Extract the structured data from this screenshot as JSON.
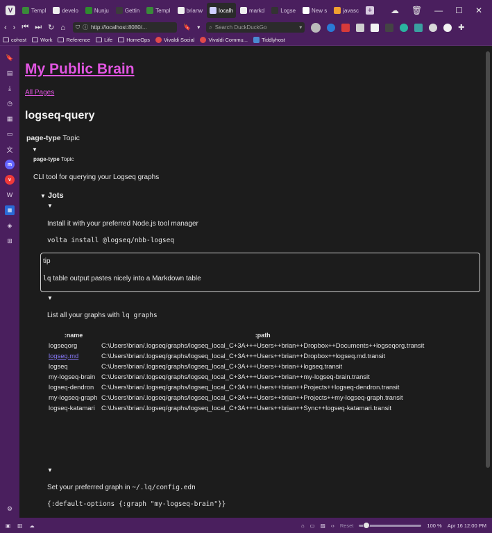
{
  "browser": {
    "tabs": [
      {
        "label": "Templ",
        "color": "#3a8a3a"
      },
      {
        "label": "develo",
        "color": "#eeeeee"
      },
      {
        "label": "Nunju",
        "color": "#2f8a2f"
      },
      {
        "label": "Gettin",
        "color": "#3c3c3c"
      },
      {
        "label": "Templ",
        "color": "#3a8a3a"
      },
      {
        "label": "brianw",
        "color": "#eeeeee"
      },
      {
        "label": "localh",
        "color": "#d0d0ff",
        "active": true
      },
      {
        "label": "markd",
        "color": "#eeeeee"
      },
      {
        "label": "Logse",
        "color": "#333333"
      },
      {
        "label": "New s",
        "color": "#ffffff"
      },
      {
        "label": "javasc",
        "color": "#f0a030"
      }
    ],
    "url": "http://localhost:8080/...",
    "search_placeholder": "Search DuckDuckGo",
    "bookmarks": [
      "cohost",
      "Work",
      "Reference",
      "Life",
      "HomeOps",
      "Vivaldi Social",
      "Vivaldi Commu...",
      "Tiddlyhost"
    ],
    "status": {
      "reset_label": "Reset",
      "zoom": "100 %",
      "datetime": "Apr 16 12:00 PM"
    }
  },
  "page": {
    "site_title": "My Public Brain",
    "all_pages_link": "All Pages",
    "page_title": "logseq-query",
    "prop_key": "page-type",
    "prop_value": "Topic",
    "prop2_key": "page-type",
    "prop2_value": "Topic",
    "description": "CLI tool for querying your Logseq graphs",
    "jots_heading": "Jots",
    "install_text": "Install it with your preferred Node.js tool manager",
    "install_cmd": "volta install @logseq/nbb-logseq",
    "tip_label": "tip",
    "tip_body_code": "lq",
    "tip_body_text": " table output pastes nicely into a Markdown table",
    "list_graphs_text": "List all your graphs with ",
    "list_graphs_code": "lq graphs",
    "table": {
      "headers": [
        ":name",
        ":path"
      ],
      "rows": [
        {
          "name": "logseqorg",
          "path": "C:\\Users\\brian/.logseq/graphs/logseq_local_C+3A+++Users++brian++Dropbox++Documents++logseqorg.transit"
        },
        {
          "name": "logseq.md",
          "path": "C:\\Users\\brian/.logseq/graphs/logseq_local_C+3A+++Users++brian++Dropbox++logseq.md.transit",
          "link": true
        },
        {
          "name": "logseq",
          "path": "C:\\Users\\brian/.logseq/graphs/logseq_local_C+3A+++Users++brian++logseq.transit"
        },
        {
          "name": "my-logseq-brain",
          "path": "C:\\Users\\brian/.logseq/graphs/logseq_local_C+3A+++Users++brian++my-logseq-brain.transit"
        },
        {
          "name": "logseq-dendron",
          "path": "C:\\Users\\brian/.logseq/graphs/logseq_local_C+3A+++Users++brian++Projects++logseq-dendron.transit"
        },
        {
          "name": "my-logseq-graph",
          "path": "C:\\Users\\brian/.logseq/graphs/logseq_local_C+3A+++Users++brian++Projects++my-logseq-graph.transit"
        },
        {
          "name": "logseq-katamari",
          "path": "C:\\Users\\brian/.logseq/graphs/logseq_local_C+3A+++Users++brian++Sync++logseq-katamari.transit"
        }
      ]
    },
    "set_graph_text": "Set your preferred graph in ",
    "set_graph_path": "~/.lq/config.edn",
    "config_code": "{:default-options {:graph \"my-logseq-brain\"}}"
  }
}
